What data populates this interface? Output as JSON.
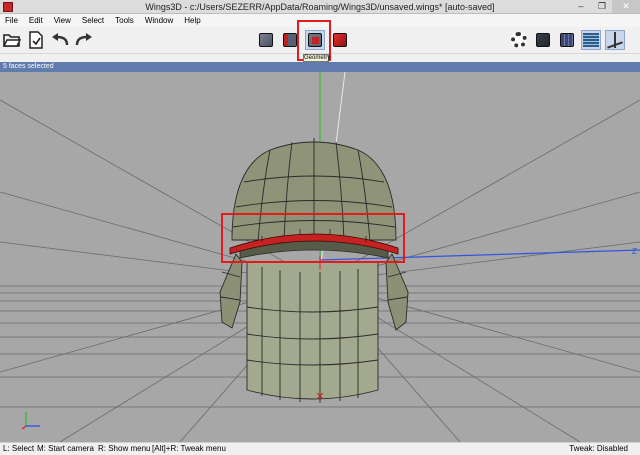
{
  "window": {
    "title": "Wings3D - c:/Users/SEZERR/AppData/Roaming/Wings3D/unsaved.wings* [auto-saved]",
    "minimize": "–",
    "maximize": "❐",
    "close": "✕"
  },
  "menubar": {
    "items": [
      "File",
      "Edit",
      "View",
      "Select",
      "Tools",
      "Window",
      "Help"
    ]
  },
  "toolbar": {
    "left_icons": [
      "open-folder-icon",
      "save-file-icon",
      "undo-icon",
      "redo-icon"
    ],
    "mode_buttons": [
      {
        "name": "vertex-mode",
        "icon": "vertex-cube-icon"
      },
      {
        "name": "edge-mode",
        "icon": "edge-cube-icon"
      },
      {
        "name": "face-mode",
        "icon": "face-cube-icon",
        "active": true
      },
      {
        "name": "body-mode",
        "icon": "body-cube-icon"
      }
    ],
    "tooltip": "Geometry",
    "right_icons": [
      "gear-icon",
      "smooth-shading-icon",
      "wireframe-icon",
      "ground-grid-icon",
      "axes-icon"
    ]
  },
  "info_line": "5 faces selected",
  "viewport": {
    "axis_label_z": "Z",
    "colors": {
      "background": "#a7a7a7",
      "mesh_face": "#8f9478",
      "selected_face": "#c62222",
      "wire": "#2a2a2a",
      "y_axis": "#3fb83f",
      "x_axis": "#3355dd"
    }
  },
  "statusbar": {
    "hints": [
      "L: Select",
      "M: Start camera",
      "R: Show menu",
      "[Alt]+R: Tweak menu"
    ],
    "tweak_status": "Tweak: Disabled"
  }
}
